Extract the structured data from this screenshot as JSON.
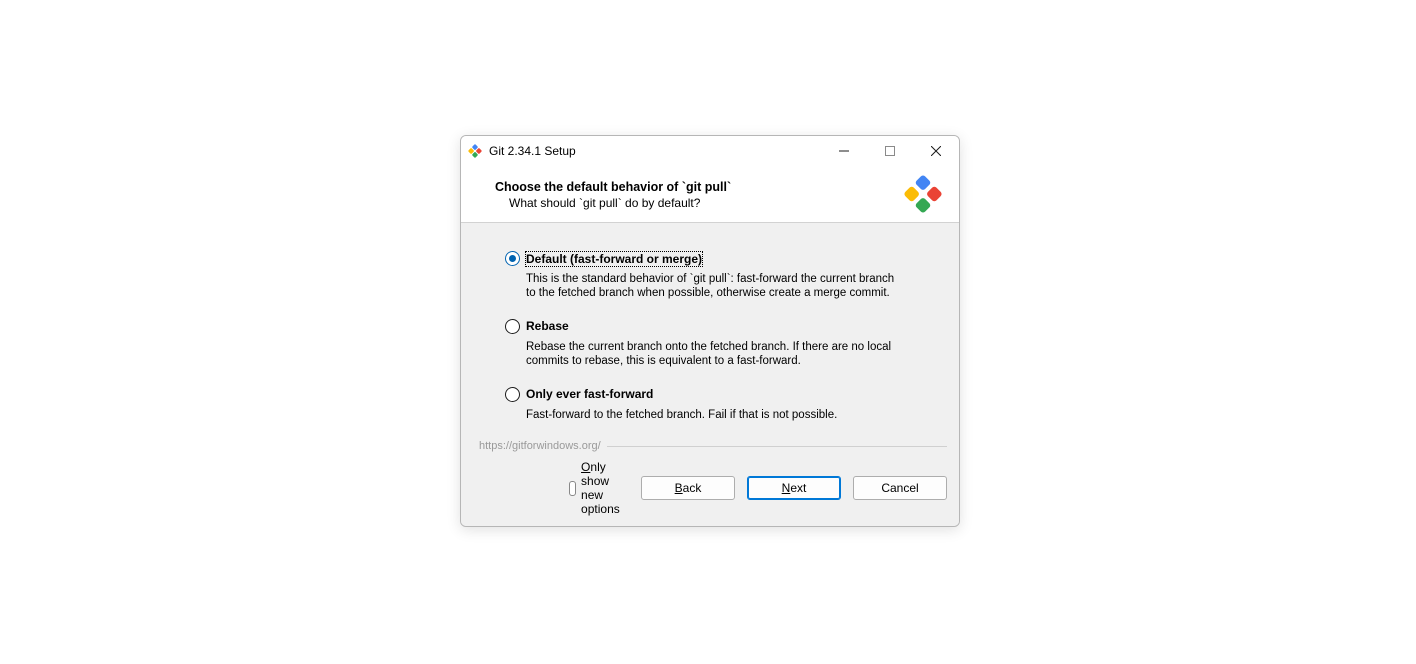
{
  "titlebar": {
    "title": "Git 2.34.1 Setup"
  },
  "header": {
    "title": "Choose the default behavior of `git pull`",
    "subtitle": "What should `git pull` do by default?"
  },
  "options": [
    {
      "label": "Default (fast-forward or merge)",
      "desc": "This is the standard behavior of `git pull`: fast-forward the current branch to the fetched branch when possible, otherwise create a merge commit.",
      "selected": true
    },
    {
      "label": "Rebase",
      "desc": "Rebase the current branch onto the fetched branch. If there are no local commits to rebase, this is equivalent to a fast-forward.",
      "selected": false
    },
    {
      "label": "Only ever fast-forward",
      "desc": "Fast-forward to the fetched branch. Fail if that is not possible.",
      "selected": false
    }
  ],
  "footer": {
    "link": "https://gitforwindows.org/",
    "checkbox_prefix": "O",
    "checkbox_rest": "nly show new options",
    "back_prefix": "B",
    "back_rest": "ack",
    "next_prefix": "N",
    "next_rest": "ext",
    "cancel": "Cancel"
  }
}
